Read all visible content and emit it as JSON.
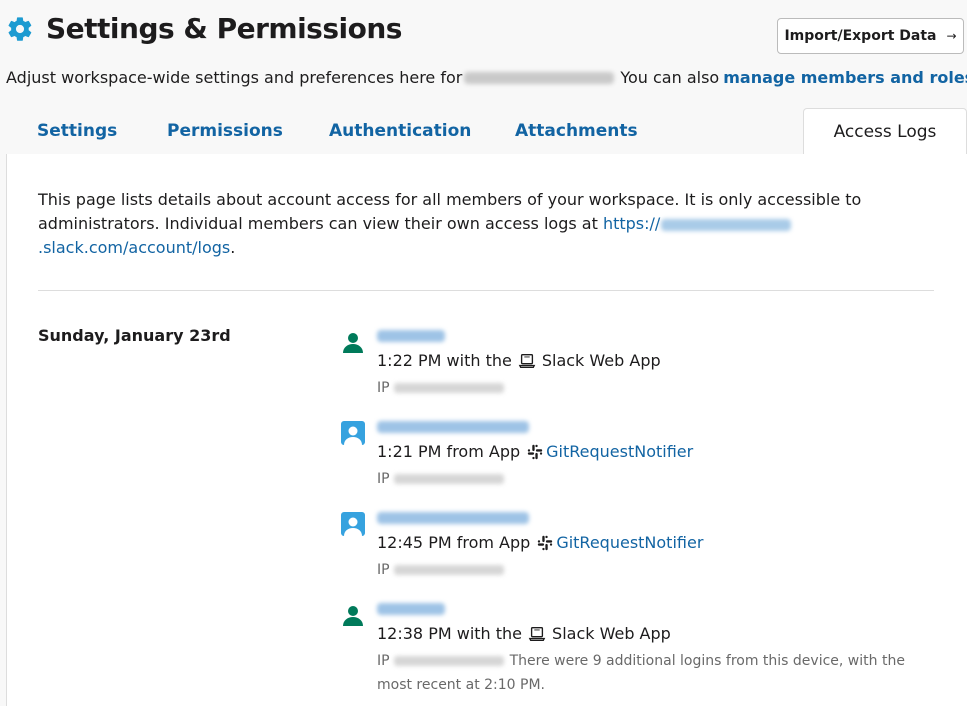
{
  "header": {
    "title": "Settings & Permissions",
    "import_export_label": "Import/Export Data",
    "import_export_arrow": "→"
  },
  "subtitle": {
    "text_before": "Adjust workspace-wide settings and preferences here for",
    "text_after": "You can also",
    "link_text": "manage members and roles",
    "text_end": "."
  },
  "tabs": [
    {
      "label": "Settings",
      "active": false
    },
    {
      "label": "Permissions",
      "active": false
    },
    {
      "label": "Authentication",
      "active": false
    },
    {
      "label": "Attachments",
      "active": false
    },
    {
      "label": "Access Logs",
      "active": true
    }
  ],
  "intro": {
    "text": "This page lists details about account access for all members of your workspace. It is only accessible to administrators. Individual members can view their own access logs at",
    "link_prefix": "https://",
    "link_suffix": ".slack.com/account/logs",
    "text_end": "."
  },
  "date_group": "Sunday, January 23rd",
  "logs": [
    {
      "time_text": "1:22 PM with the",
      "source": "Slack Web App",
      "source_is_link": false,
      "ip_label": "IP",
      "note": ""
    },
    {
      "time_text": "1:21 PM from App",
      "source": "GitRequestNotifier",
      "source_is_link": true,
      "ip_label": "IP",
      "note": ""
    },
    {
      "time_text": "12:45 PM from App",
      "source": "GitRequestNotifier",
      "source_is_link": true,
      "ip_label": "IP",
      "note": ""
    },
    {
      "time_text": "12:38 PM with the",
      "source": "Slack Web App",
      "source_is_link": false,
      "ip_label": "IP",
      "note": "There were 9 additional logins from this device, with the most recent at 2:10 PM."
    }
  ],
  "colors": {
    "accent_blue": "#1264a3",
    "gear_blue": "#1d9bd1",
    "user_green": "#007a5a",
    "app_blue": "#36a2df"
  },
  "icons": {
    "gear": "gear-icon",
    "user": "user-avatar-icon",
    "app": "app-avatar-icon",
    "laptop": "laptop-icon",
    "slack": "slack-logo-icon"
  }
}
